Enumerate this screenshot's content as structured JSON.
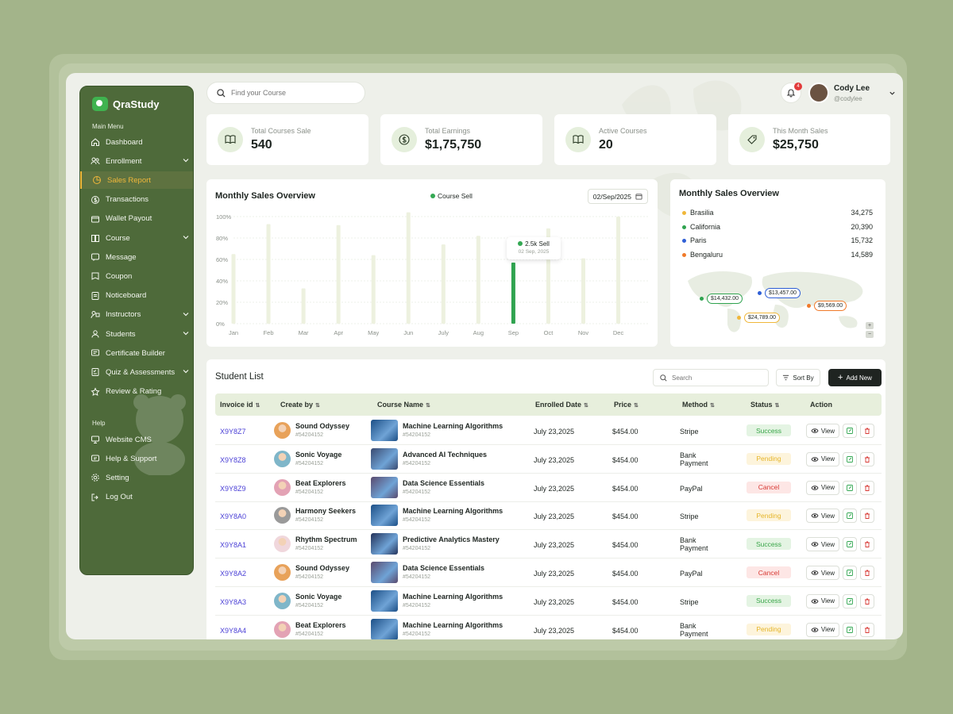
{
  "app": {
    "name": "QraStudy"
  },
  "sidebar": {
    "main_menu_label": "Main Menu",
    "help_label": "Help",
    "items": [
      {
        "label": "Dashboard",
        "icon": "home-icon",
        "has_chevron": false
      },
      {
        "label": "Enrollment",
        "icon": "users-icon",
        "has_chevron": true
      },
      {
        "label": "Sales Report",
        "icon": "chart-pie-icon",
        "has_chevron": false,
        "active": true
      },
      {
        "label": "Transactions",
        "icon": "dollar-icon",
        "has_chevron": false
      },
      {
        "label": "Wallet Payout",
        "icon": "wallet-icon",
        "has_chevron": false
      },
      {
        "label": "Course",
        "icon": "book-icon",
        "has_chevron": true
      },
      {
        "label": "Message",
        "icon": "message-icon",
        "has_chevron": false
      },
      {
        "label": "Coupon",
        "icon": "coupon-icon",
        "has_chevron": false
      },
      {
        "label": "Noticeboard",
        "icon": "notice-icon",
        "has_chevron": false
      },
      {
        "label": "Instructors",
        "icon": "instructor-icon",
        "has_chevron": true
      },
      {
        "label": "Students",
        "icon": "students-icon",
        "has_chevron": true
      },
      {
        "label": "Certificate Builder",
        "icon": "certificate-icon",
        "has_chevron": false
      },
      {
        "label": "Quiz & Assessments",
        "icon": "quiz-icon",
        "has_chevron": true
      },
      {
        "label": "Review & Rating",
        "icon": "star-icon",
        "has_chevron": false
      }
    ],
    "help_items": [
      {
        "label": "Website CMS",
        "icon": "monitor-icon"
      },
      {
        "label": "Help & Support",
        "icon": "support-icon"
      },
      {
        "label": "Setting",
        "icon": "gear-icon"
      },
      {
        "label": "Log Out",
        "icon": "logout-icon"
      }
    ]
  },
  "topbar": {
    "search_placeholder": "Find your Course",
    "notification_count": "4",
    "user_name": "Cody Lee",
    "user_handle": "@codylee"
  },
  "stats": [
    {
      "label": "Total Courses Sale",
      "value": "540",
      "icon": "book-open-icon"
    },
    {
      "label": "Total Earnings",
      "value": "$1,75,750",
      "icon": "dollar-circle-icon"
    },
    {
      "label": "Active Courses",
      "value": "20",
      "icon": "book-open-icon"
    },
    {
      "label": "This Month Sales",
      "value": "$25,750",
      "icon": "tag-icon"
    }
  ],
  "sales_chart": {
    "title": "Monthly Sales Overview",
    "legend": "Course Sell",
    "date": "02/Sep/2025",
    "tooltip_value": "2.5k Sell",
    "tooltip_date": "02 Sep, 2025",
    "colors": {
      "bar": "#edf1df",
      "highlight": "#2fa34f"
    }
  },
  "chart_data": {
    "type": "bar",
    "categories": [
      "Jan",
      "Feb",
      "Mar",
      "Apr",
      "May",
      "Jun",
      "July",
      "Aug",
      "Sep",
      "Oct",
      "Nov",
      "Dec"
    ],
    "series": [
      {
        "name": "Course Sell",
        "values": [
          65,
          93,
          33,
          92,
          64,
          104,
          74,
          82,
          57,
          89,
          61,
          100
        ]
      }
    ],
    "highlight_index": 8,
    "yticks": [
      "0%",
      "20%",
      "40%",
      "60%",
      "80%",
      "100%"
    ],
    "ylim": [
      0,
      100
    ],
    "grid": true
  },
  "map_card": {
    "title": "Monthly Sales Overview",
    "locations": [
      {
        "name": "Brasilia",
        "value": "34,275",
        "color": "#f0b73a"
      },
      {
        "name": "California",
        "value": "20,390",
        "color": "#2fa34f"
      },
      {
        "name": "Paris",
        "value": "15,732",
        "color": "#2f5fd6"
      },
      {
        "name": "Bengaluru",
        "value": "14,589",
        "color": "#f07a2a"
      }
    ],
    "pins": [
      {
        "label": "$14,432.00",
        "color": "#2fa34f"
      },
      {
        "label": "$13,457.00",
        "color": "#2f5fd6"
      },
      {
        "label": "$9,569.00",
        "color": "#f07a2a"
      },
      {
        "label": "$24,789.00",
        "color": "#f0b73a"
      }
    ],
    "zoom_in": "+",
    "zoom_out": "−"
  },
  "students": {
    "title": "Student List",
    "search_placeholder": "Search",
    "sort_label": "Sort By",
    "add_label": "Add New",
    "columns": [
      "Invoice id",
      "Create by",
      "Course Name",
      "Enrolled Date",
      "Price",
      "Method",
      "Status",
      "Action"
    ],
    "view_label": "View",
    "rows": [
      {
        "invoice": "X9Y8Z7",
        "name": "Sound Odyssey",
        "pid": "#54204152",
        "course": "Machine Learning Algorithms",
        "cid": "#54204152",
        "date": "July 23,2025",
        "price": "$454.00",
        "method1": "Stripe",
        "method2": "",
        "status": "Success",
        "avatar": "#e8a25a",
        "thumb": "#1c4f86"
      },
      {
        "invoice": "X9Y8Z8",
        "name": "Sonic Voyage",
        "pid": "#54204152",
        "course": "Advanced AI Techniques",
        "cid": "#54204152",
        "date": "July 23,2025",
        "price": "$454.00",
        "method1": "Bank",
        "method2": "Payment",
        "status": "Pending",
        "avatar": "#7fb6c9",
        "thumb": "#3a4a70"
      },
      {
        "invoice": "X9Y8Z9",
        "name": "Beat Explorers",
        "pid": "#54204152",
        "course": "Data Science Essentials",
        "cid": "#54204152",
        "date": "July 23,2025",
        "price": "$454.00",
        "method1": "PayPal",
        "method2": "",
        "status": "Cancel",
        "avatar": "#e3a2b4",
        "thumb": "#5a4a6e"
      },
      {
        "invoice": "X9Y8A0",
        "name": "Harmony Seekers",
        "pid": "#54204152",
        "course": "Machine Learning Algorithms",
        "cid": "#54204152",
        "date": "July 23,2025",
        "price": "$454.00",
        "method1": "Stripe",
        "method2": "",
        "status": "Pending",
        "avatar": "#9a9a9a",
        "thumb": "#1c4f86"
      },
      {
        "invoice": "X9Y8A1",
        "name": "Rhythm Spectrum",
        "pid": "#54204152",
        "course": "Predictive Analytics Mastery",
        "cid": "#54204152",
        "date": "July 23,2025",
        "price": "$454.00",
        "method1": "Bank",
        "method2": "Payment",
        "status": "Success",
        "avatar": "#f0d7dc",
        "thumb": "#23325a"
      },
      {
        "invoice": "X9Y8A2",
        "name": "Sound Odyssey",
        "pid": "#54204152",
        "course": "Data Science Essentials",
        "cid": "#54204152",
        "date": "July 23,2025",
        "price": "$454.00",
        "method1": "PayPal",
        "method2": "",
        "status": "Cancel",
        "avatar": "#e8a25a",
        "thumb": "#5a4a6e"
      },
      {
        "invoice": "X9Y8A3",
        "name": "Sonic Voyage",
        "pid": "#54204152",
        "course": "Machine Learning Algorithms",
        "cid": "#54204152",
        "date": "July 23,2025",
        "price": "$454.00",
        "method1": "Stripe",
        "method2": "",
        "status": "Success",
        "avatar": "#7fb6c9",
        "thumb": "#1c4f86"
      },
      {
        "invoice": "X9Y8A4",
        "name": "Beat Explorers",
        "pid": "#54204152",
        "course": "Machine Learning Algorithms",
        "cid": "#54204152",
        "date": "July 23,2025",
        "price": "$454.00",
        "method1": "Bank",
        "method2": "Payment",
        "status": "Pending",
        "avatar": "#e3a2b4",
        "thumb": "#1c4f86"
      }
    ]
  }
}
